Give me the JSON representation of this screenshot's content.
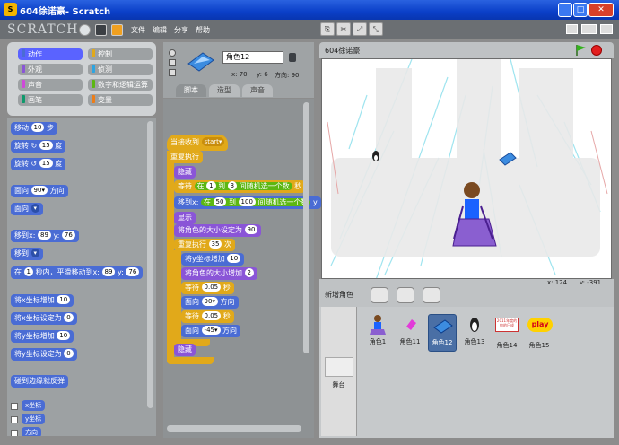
{
  "window": {
    "title": "604徐诺豪- Scratch",
    "minimize": "_",
    "maximize": "□",
    "close": "✕"
  },
  "menu": {
    "logo": "SCRATCH",
    "items": [
      "文件",
      "编辑",
      "分享",
      "帮助"
    ]
  },
  "categories": [
    {
      "label": "动作",
      "color": "#4a6cd4",
      "selected": true
    },
    {
      "label": "控制",
      "color": "#e1a91a"
    },
    {
      "label": "外观",
      "color": "#8a55d7"
    },
    {
      "label": "侦测",
      "color": "#2ca5e2"
    },
    {
      "label": "声音",
      "color": "#cf4ad9"
    },
    {
      "label": "数字和逻辑运算",
      "color": "#5cb712"
    },
    {
      "label": "画笔",
      "color": "#0e9a6c"
    },
    {
      "label": "变量",
      "color": "#ee7d16"
    }
  ],
  "palette": {
    "move": {
      "pre": "移动",
      "val": "10",
      "post": "步"
    },
    "turn_cw": {
      "pre": "旋转 ↻",
      "val": "15",
      "post": "度"
    },
    "turn_ccw": {
      "pre": "旋转 ↺",
      "val": "15",
      "post": "度"
    },
    "point_dir": {
      "pre": "面向",
      "val": "90▾",
      "post": "方向"
    },
    "point_towards": {
      "pre": "面向",
      "val": "▾"
    },
    "goto_xy": {
      "pre": "移到x:",
      "x": "89",
      "mid": "y:",
      "y": "76"
    },
    "goto": {
      "pre": "移到",
      "val": "▾"
    },
    "glide": {
      "pre": "在",
      "secs": "1",
      "mid": "秒内，平滑移动到x:",
      "x": "89",
      "ymid": "y:",
      "y": "76"
    },
    "change_x": {
      "pre": "将x坐标增加",
      "val": "10"
    },
    "set_x": {
      "pre": "将x坐标设定为",
      "val": "0"
    },
    "change_y": {
      "pre": "将y坐标增加",
      "val": "10"
    },
    "set_y": {
      "pre": "将y坐标设定为",
      "val": "0"
    },
    "bounce": "碰到边缘就反弹",
    "rep_x": "x坐标",
    "rep_y": "y坐标",
    "rep_dir": "方向"
  },
  "sprite": {
    "name": "角色12",
    "x_label": "x: 70",
    "y_label": "y: 6",
    "dir_label": "方向: 90"
  },
  "tabs": [
    "脚本",
    "造型",
    "声音"
  ],
  "script": {
    "hat": {
      "pre": "当接收到",
      "val": "start▾"
    },
    "forever": "重复执行",
    "hide1": "隐藏",
    "wait_rand": {
      "pre": "等待",
      "mid1": "在",
      "a": "1",
      "mid2": "到",
      "b": "3",
      "mid3": "间随机选一个数",
      "post": "秒"
    },
    "goto_rand": {
      "pre": "移到x:",
      "mid1": "在",
      "a": "50",
      "mid2": "到",
      "b": "100",
      "mid3": "间随机选一个数",
      "post": "y"
    },
    "show": "显示",
    "set_size": {
      "pre": "将角色的大小设定为",
      "val": "90"
    },
    "repeat": {
      "pre": "重复执行",
      "val": "35",
      "post": "次"
    },
    "change_y": {
      "pre": "将y坐标增加",
      "val": "10"
    },
    "change_size": {
      "pre": "将角色的大小增加",
      "val": "2"
    },
    "wait1": {
      "pre": "等待",
      "val": "0.05",
      "post": "秒"
    },
    "dir1": {
      "pre": "面向",
      "val": "90▾",
      "post": "方向"
    },
    "wait2": {
      "pre": "等待",
      "val": "0.05",
      "post": "秒"
    },
    "dir2": {
      "pre": "面向",
      "val": "-45▾",
      "post": "方向"
    },
    "hide2": "隐藏"
  },
  "stage": {
    "title": "604徐诺豪",
    "mouse_x": "x: 124",
    "mouse_y": "y: -391"
  },
  "sprites_panel": {
    "new_sprite": "新增角色",
    "stage_label": "舞台"
  },
  "sprites": [
    {
      "name": "角色1",
      "icon": "skier-icon"
    },
    {
      "name": "角色11",
      "icon": "pink-gem-icon"
    },
    {
      "name": "角色12",
      "icon": "blue-gem-icon",
      "selected": true
    },
    {
      "name": "角色13",
      "icon": "penguin-icon"
    },
    {
      "name": "角色14",
      "icon": "sign-icon",
      "text": "2011年度的\n你的日成"
    },
    {
      "name": "角色15",
      "icon": "play-logo-icon",
      "text": "play"
    }
  ]
}
